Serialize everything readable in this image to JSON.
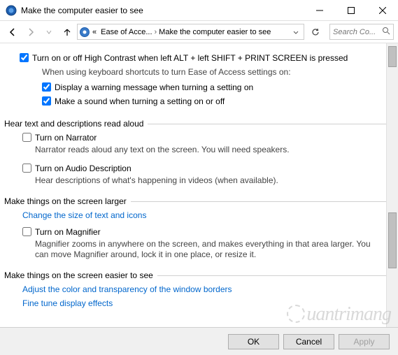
{
  "window": {
    "title": "Make the computer easier to see"
  },
  "breadcrumb": {
    "prefix": "«",
    "part1": "Ease of Acce...",
    "part2": "Make the computer easier to see"
  },
  "search": {
    "placeholder": "Search Co..."
  },
  "checkboxes": {
    "high_contrast": {
      "label": "Turn on or off High Contrast when left ALT + left SHIFT + PRINT SCREEN is pressed",
      "checked": true
    },
    "shortcut_desc": "When using keyboard shortcuts to turn Ease of Access settings on:",
    "warning": {
      "label": "Display a warning message when turning a setting on",
      "checked": true
    },
    "sound": {
      "label": "Make a sound when turning a setting on or off",
      "checked": true
    }
  },
  "sections": {
    "hear": {
      "title": "Hear text and descriptions read aloud",
      "narrator": {
        "label": "Turn on Narrator",
        "checked": false,
        "desc": "Narrator reads aloud any text on the screen. You will need speakers."
      },
      "audio": {
        "label": "Turn on Audio Description",
        "checked": false,
        "desc": "Hear descriptions of what's happening in videos (when available)."
      }
    },
    "larger": {
      "title": "Make things on the screen larger",
      "size_link": "Change the size of text and icons",
      "magnifier": {
        "label": "Turn on Magnifier",
        "checked": false,
        "desc": "Magnifier zooms in anywhere on the screen, and makes everything in that area larger. You can move Magnifier around, lock it in one place, or resize it."
      }
    },
    "easier": {
      "title": "Make things on the screen easier to see",
      "color_link": "Adjust the color and transparency of the window borders",
      "effects_link": "Fine tune display effects"
    }
  },
  "buttons": {
    "ok": "OK",
    "cancel": "Cancel",
    "apply": "Apply"
  },
  "watermark": "uantrimang"
}
